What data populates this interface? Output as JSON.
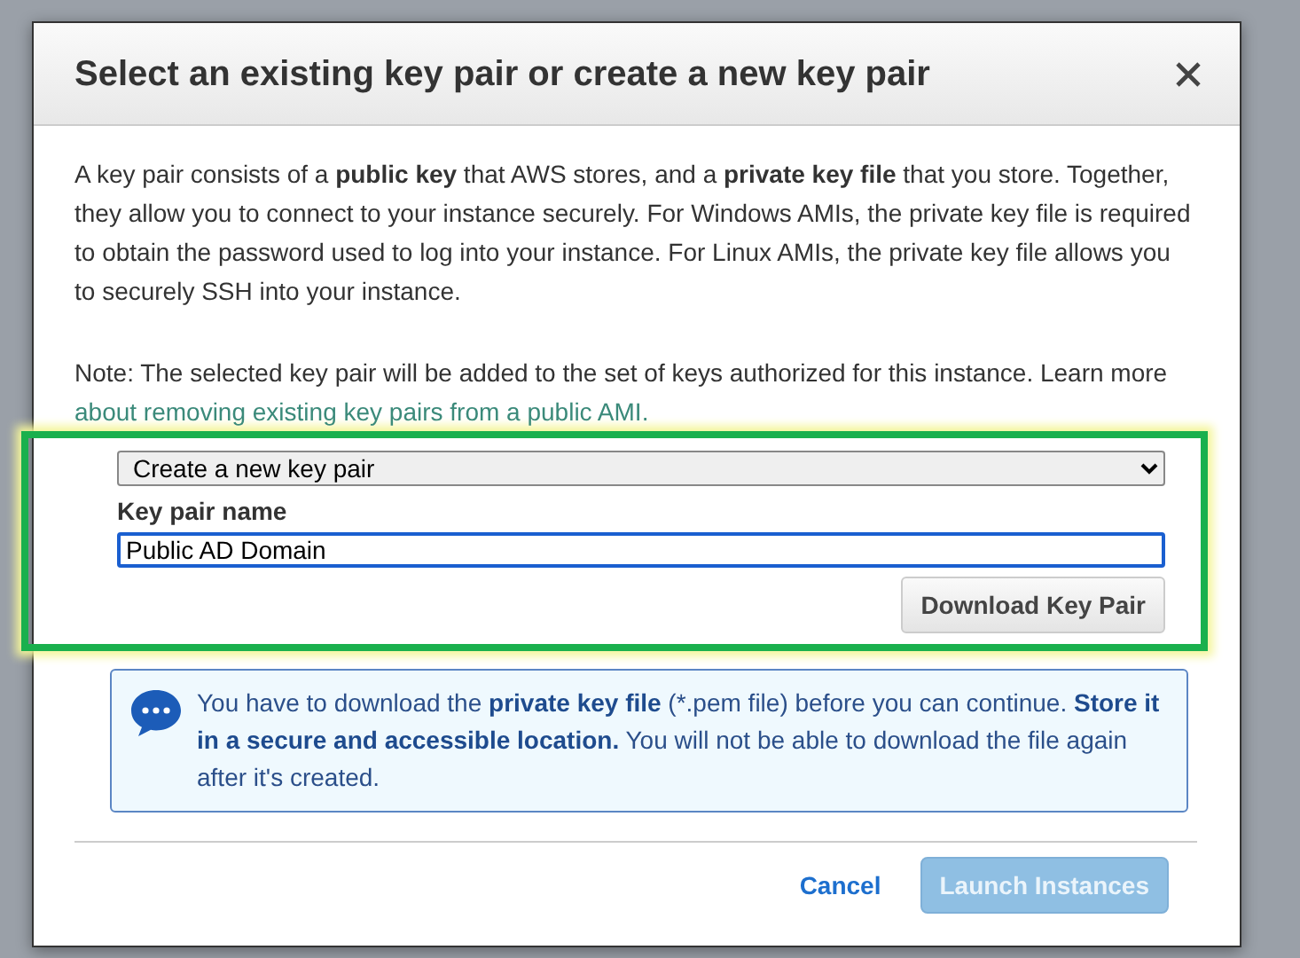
{
  "dialog": {
    "title": "Select an existing key pair or create a new key pair"
  },
  "intro": "A key pair consists of a **public key** that AWS stores, and a **private key file** that you store. Together, they allow you to connect to your instance securely. For Windows AMIs, the private key file is required to obtain the password used to log into your instance. For Linux AMIs, the private key file allows you to securely SSH into your instance.",
  "note": {
    "text": "Note: The selected key pair will be added to the set of keys authorized for this instance. Learn more",
    "link": "about removing existing key pairs from a public AMI."
  },
  "key_form": {
    "select": {
      "value": "Create a new key pair"
    },
    "name_label": "Key pair name",
    "name_field": {
      "value": "Public AD Domain"
    },
    "download_button": "Download Key Pair"
  },
  "info": "You have to download the **private key file** (*.pem file) before you can continue. **Store it in a secure and accessible location.** You will not be able to download the file again after it's created.",
  "buttons": [
    {
      "kind": "link",
      "label": "Cancel",
      "disabled": false
    },
    {
      "kind": "primary",
      "label": "Launch Instances",
      "disabled": true
    }
  ]
}
